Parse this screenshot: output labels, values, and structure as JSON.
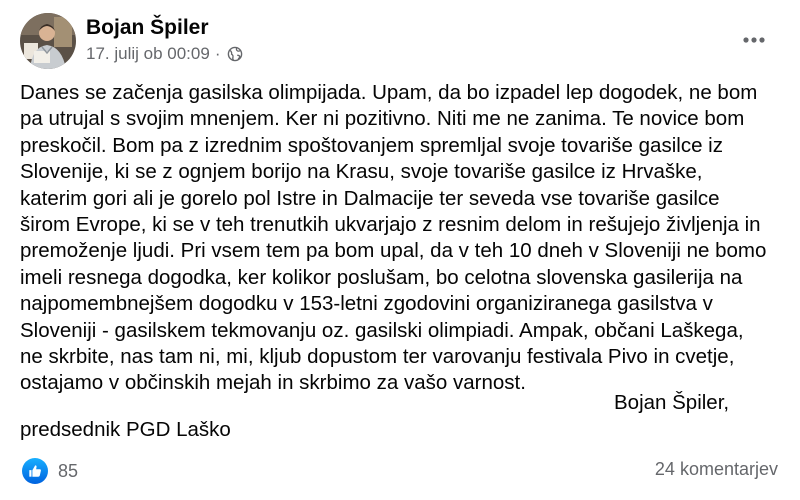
{
  "post": {
    "author": {
      "name": "Bojan Špiler",
      "avatar_icon": "profile-photo"
    },
    "meta": {
      "date": "17. julij ob 00:09",
      "separator": "·",
      "audience_icon": "globe-icon"
    },
    "more_icon": "more-options-icon",
    "body_lines": [
      "Danes se začenja gasilska olimpijada. Upam, da bo izpadel lep dogodek, ne bom",
      "pa utrujal s svojim mnenjem. Ker ni pozitivno. Niti me ne zanima. Te novice bom",
      "preskočil. Bom pa z izrednim spoštovanjem spremljal svoje tovariše gasilce iz",
      "Slovenije, ki se z ognjem borijo na Krasu, svoje tovariše gasilce iz Hrvaške,",
      "katerim gori ali je gorelo pol Istre in Dalmacije ter seveda vse tovariše gasilce",
      "širom Evrope, ki se v teh trenutkih ukvarjajo z resnim delom in rešujejo življenja in",
      "premoženje ljudi. Pri vsem tem pa bom upal, da v teh 10 dneh v Sloveniji ne bomo",
      "imeli resnega dogodka, ker kolikor poslušam, bo celotna slovenska gasilerija na",
      "najpomembnejšem dogodku v 153-letni zgodovini organiziranega gasilstva v",
      "Sloveniji - gasilskem tekmovanju oz. gasilski olimpiadi. Ampak, občani Laškega,",
      "ne skrbite, nas tam ni, mi, kljub dopustom ter varovanju festivala Pivo in cvetje,",
      "ostajamo v občinskih mejah in skrbimo za vašo varnost."
    ],
    "signature": "Bojan Špiler,",
    "role": "predsednik PGD Laško"
  },
  "footer": {
    "reaction_icon": "like-icon",
    "reaction_count": "85",
    "comments": "24 komentarjev"
  },
  "colors": {
    "text": "#050505",
    "secondary_text": "#65676b",
    "like_blue": "#1877f2"
  }
}
